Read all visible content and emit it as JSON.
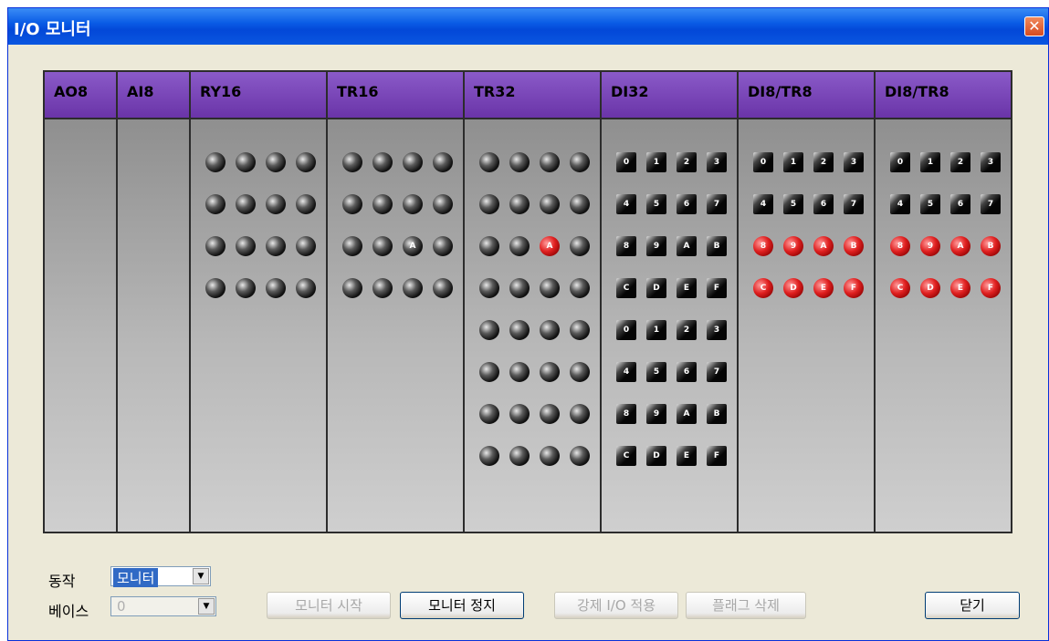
{
  "window": {
    "title": "I/O 모니터",
    "close": "✕"
  },
  "columns": [
    {
      "label": "AO8",
      "leds": []
    },
    {
      "label": "AI8",
      "leds": []
    },
    {
      "label": "RY16",
      "leds": [
        [
          {
            "shape": "circle",
            "on": false,
            "text": ""
          },
          {
            "shape": "circle",
            "on": false,
            "text": ""
          },
          {
            "shape": "circle",
            "on": false,
            "text": ""
          },
          {
            "shape": "circle",
            "on": false,
            "text": ""
          }
        ],
        [
          {
            "shape": "circle",
            "on": false,
            "text": ""
          },
          {
            "shape": "circle",
            "on": false,
            "text": ""
          },
          {
            "shape": "circle",
            "on": false,
            "text": ""
          },
          {
            "shape": "circle",
            "on": false,
            "text": ""
          }
        ],
        [
          {
            "shape": "circle",
            "on": false,
            "text": ""
          },
          {
            "shape": "circle",
            "on": false,
            "text": ""
          },
          {
            "shape": "circle",
            "on": false,
            "text": ""
          },
          {
            "shape": "circle",
            "on": false,
            "text": ""
          }
        ],
        [
          {
            "shape": "circle",
            "on": false,
            "text": ""
          },
          {
            "shape": "circle",
            "on": false,
            "text": ""
          },
          {
            "shape": "circle",
            "on": false,
            "text": ""
          },
          {
            "shape": "circle",
            "on": false,
            "text": ""
          }
        ]
      ]
    },
    {
      "label": "TR16",
      "leds": [
        [
          {
            "shape": "circle",
            "on": false,
            "text": ""
          },
          {
            "shape": "circle",
            "on": false,
            "text": ""
          },
          {
            "shape": "circle",
            "on": false,
            "text": ""
          },
          {
            "shape": "circle",
            "on": false,
            "text": ""
          }
        ],
        [
          {
            "shape": "circle",
            "on": false,
            "text": ""
          },
          {
            "shape": "circle",
            "on": false,
            "text": ""
          },
          {
            "shape": "circle",
            "on": false,
            "text": ""
          },
          {
            "shape": "circle",
            "on": false,
            "text": ""
          }
        ],
        [
          {
            "shape": "circle",
            "on": false,
            "text": ""
          },
          {
            "shape": "circle",
            "on": false,
            "text": ""
          },
          {
            "shape": "circle",
            "on": false,
            "text": "A"
          },
          {
            "shape": "circle",
            "on": false,
            "text": ""
          }
        ],
        [
          {
            "shape": "circle",
            "on": false,
            "text": ""
          },
          {
            "shape": "circle",
            "on": false,
            "text": ""
          },
          {
            "shape": "circle",
            "on": false,
            "text": ""
          },
          {
            "shape": "circle",
            "on": false,
            "text": ""
          }
        ]
      ]
    },
    {
      "label": "TR32",
      "leds": [
        [
          {
            "shape": "circle",
            "on": false,
            "text": ""
          },
          {
            "shape": "circle",
            "on": false,
            "text": ""
          },
          {
            "shape": "circle",
            "on": false,
            "text": ""
          },
          {
            "shape": "circle",
            "on": false,
            "text": ""
          }
        ],
        [
          {
            "shape": "circle",
            "on": false,
            "text": ""
          },
          {
            "shape": "circle",
            "on": false,
            "text": ""
          },
          {
            "shape": "circle",
            "on": false,
            "text": ""
          },
          {
            "shape": "circle",
            "on": false,
            "text": ""
          }
        ],
        [
          {
            "shape": "circle",
            "on": false,
            "text": ""
          },
          {
            "shape": "circle",
            "on": false,
            "text": ""
          },
          {
            "shape": "circle",
            "on": true,
            "text": "A"
          },
          {
            "shape": "circle",
            "on": false,
            "text": ""
          }
        ],
        [
          {
            "shape": "circle",
            "on": false,
            "text": ""
          },
          {
            "shape": "circle",
            "on": false,
            "text": ""
          },
          {
            "shape": "circle",
            "on": false,
            "text": ""
          },
          {
            "shape": "circle",
            "on": false,
            "text": ""
          }
        ],
        [
          {
            "shape": "circle",
            "on": false,
            "text": ""
          },
          {
            "shape": "circle",
            "on": false,
            "text": ""
          },
          {
            "shape": "circle",
            "on": false,
            "text": ""
          },
          {
            "shape": "circle",
            "on": false,
            "text": ""
          }
        ],
        [
          {
            "shape": "circle",
            "on": false,
            "text": ""
          },
          {
            "shape": "circle",
            "on": false,
            "text": ""
          },
          {
            "shape": "circle",
            "on": false,
            "text": ""
          },
          {
            "shape": "circle",
            "on": false,
            "text": ""
          }
        ],
        [
          {
            "shape": "circle",
            "on": false,
            "text": ""
          },
          {
            "shape": "circle",
            "on": false,
            "text": ""
          },
          {
            "shape": "circle",
            "on": false,
            "text": ""
          },
          {
            "shape": "circle",
            "on": false,
            "text": ""
          }
        ],
        [
          {
            "shape": "circle",
            "on": false,
            "text": ""
          },
          {
            "shape": "circle",
            "on": false,
            "text": ""
          },
          {
            "shape": "circle",
            "on": false,
            "text": ""
          },
          {
            "shape": "circle",
            "on": false,
            "text": ""
          }
        ]
      ]
    },
    {
      "label": "DI32",
      "leds": [
        [
          {
            "shape": "square",
            "on": false,
            "text": "0"
          },
          {
            "shape": "square",
            "on": false,
            "text": "1"
          },
          {
            "shape": "square",
            "on": false,
            "text": "2"
          },
          {
            "shape": "square",
            "on": false,
            "text": "3"
          }
        ],
        [
          {
            "shape": "square",
            "on": false,
            "text": "4"
          },
          {
            "shape": "square",
            "on": false,
            "text": "5"
          },
          {
            "shape": "square",
            "on": false,
            "text": "6"
          },
          {
            "shape": "square",
            "on": false,
            "text": "7"
          }
        ],
        [
          {
            "shape": "square",
            "on": false,
            "text": "8"
          },
          {
            "shape": "square",
            "on": false,
            "text": "9"
          },
          {
            "shape": "square",
            "on": false,
            "text": "A"
          },
          {
            "shape": "square",
            "on": false,
            "text": "B"
          }
        ],
        [
          {
            "shape": "square",
            "on": false,
            "text": "C"
          },
          {
            "shape": "square",
            "on": false,
            "text": "D"
          },
          {
            "shape": "square",
            "on": false,
            "text": "E"
          },
          {
            "shape": "square",
            "on": false,
            "text": "F"
          }
        ],
        [
          {
            "shape": "square",
            "on": false,
            "text": "0"
          },
          {
            "shape": "square",
            "on": false,
            "text": "1"
          },
          {
            "shape": "square",
            "on": false,
            "text": "2"
          },
          {
            "shape": "square",
            "on": false,
            "text": "3"
          }
        ],
        [
          {
            "shape": "square",
            "on": false,
            "text": "4"
          },
          {
            "shape": "square",
            "on": false,
            "text": "5"
          },
          {
            "shape": "square",
            "on": false,
            "text": "6"
          },
          {
            "shape": "square",
            "on": false,
            "text": "7"
          }
        ],
        [
          {
            "shape": "square",
            "on": false,
            "text": "8"
          },
          {
            "shape": "square",
            "on": false,
            "text": "9"
          },
          {
            "shape": "square",
            "on": false,
            "text": "A"
          },
          {
            "shape": "square",
            "on": false,
            "text": "B"
          }
        ],
        [
          {
            "shape": "square",
            "on": false,
            "text": "C"
          },
          {
            "shape": "square",
            "on": false,
            "text": "D"
          },
          {
            "shape": "square",
            "on": false,
            "text": "E"
          },
          {
            "shape": "square",
            "on": false,
            "text": "F"
          }
        ]
      ]
    },
    {
      "label": "DI8/TR8",
      "leds": [
        [
          {
            "shape": "square",
            "on": false,
            "text": "0"
          },
          {
            "shape": "square",
            "on": false,
            "text": "1"
          },
          {
            "shape": "square",
            "on": false,
            "text": "2"
          },
          {
            "shape": "square",
            "on": false,
            "text": "3"
          }
        ],
        [
          {
            "shape": "square",
            "on": false,
            "text": "4"
          },
          {
            "shape": "square",
            "on": false,
            "text": "5"
          },
          {
            "shape": "square",
            "on": false,
            "text": "6"
          },
          {
            "shape": "square",
            "on": false,
            "text": "7"
          }
        ],
        [
          {
            "shape": "square",
            "on": true,
            "text": "8"
          },
          {
            "shape": "square",
            "on": true,
            "text": "9"
          },
          {
            "shape": "square",
            "on": true,
            "text": "A"
          },
          {
            "shape": "square",
            "on": true,
            "text": "B"
          }
        ],
        [
          {
            "shape": "square",
            "on": true,
            "text": "C"
          },
          {
            "shape": "square",
            "on": true,
            "text": "D"
          },
          {
            "shape": "square",
            "on": true,
            "text": "E"
          },
          {
            "shape": "square",
            "on": true,
            "text": "F"
          }
        ]
      ]
    },
    {
      "label": "DI8/TR8",
      "leds": [
        [
          {
            "shape": "square",
            "on": false,
            "text": "0"
          },
          {
            "shape": "square",
            "on": false,
            "text": "1"
          },
          {
            "shape": "square",
            "on": false,
            "text": "2"
          },
          {
            "shape": "square",
            "on": false,
            "text": "3"
          }
        ],
        [
          {
            "shape": "square",
            "on": false,
            "text": "4"
          },
          {
            "shape": "square",
            "on": false,
            "text": "5"
          },
          {
            "shape": "square",
            "on": false,
            "text": "6"
          },
          {
            "shape": "square",
            "on": false,
            "text": "7"
          }
        ],
        [
          {
            "shape": "square",
            "on": true,
            "text": "8"
          },
          {
            "shape": "square",
            "on": true,
            "text": "9"
          },
          {
            "shape": "square",
            "on": true,
            "text": "A"
          },
          {
            "shape": "square",
            "on": true,
            "text": "B"
          }
        ],
        [
          {
            "shape": "square",
            "on": true,
            "text": "C"
          },
          {
            "shape": "square",
            "on": true,
            "text": "D"
          },
          {
            "shape": "square",
            "on": true,
            "text": "E"
          },
          {
            "shape": "square",
            "on": true,
            "text": "F"
          }
        ]
      ]
    }
  ],
  "controls": {
    "mode_label": "동작",
    "mode_value": "모니터",
    "base_label": "베이스",
    "base_value": "0",
    "start_button": "모니터 시작",
    "stop_button": "모니터 정지",
    "force_io_button": "강제 I/O 적용",
    "flag_delete_button": "플래그 삭제",
    "close_button": "닫기"
  },
  "colors": {
    "header_purple": "#7a44b8",
    "led_on_red": "#e02020",
    "titlebar_blue": "#0a56e0"
  }
}
